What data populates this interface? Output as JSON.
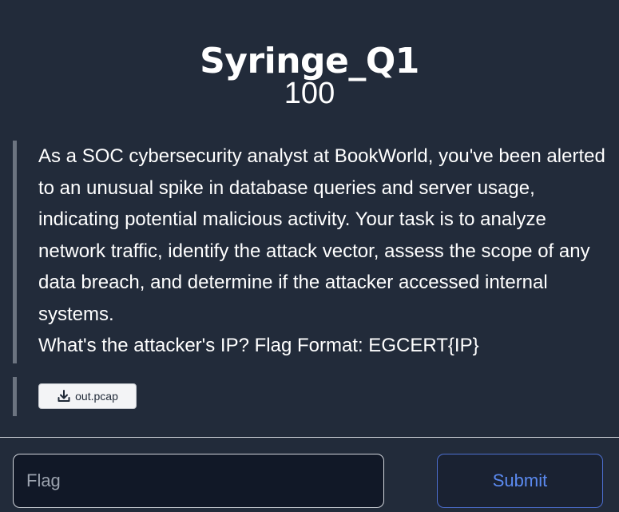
{
  "challenge": {
    "title": "Syringe_Q1",
    "points": "100",
    "description": [
      "As a SOC cybersecurity analyst at BookWorld, you've been alerted to an unusual spike in database queries and server usage, indicating potential malicious activity. Your task is to analyze network traffic, identify the attack vector, assess the scope of any data breach, and determine if the attacker accessed internal systems.",
      "What's the attacker's IP? Flag Format: EGCERT{IP}"
    ],
    "files": [
      {
        "name": "out.pcap",
        "icon": "download-icon"
      }
    ]
  },
  "form": {
    "flag_placeholder": "Flag",
    "flag_value": "",
    "submit_label": "Submit"
  },
  "colors": {
    "background": "#222b3a",
    "accent": "#5b8af0",
    "quote_bar": "#6c7480"
  }
}
